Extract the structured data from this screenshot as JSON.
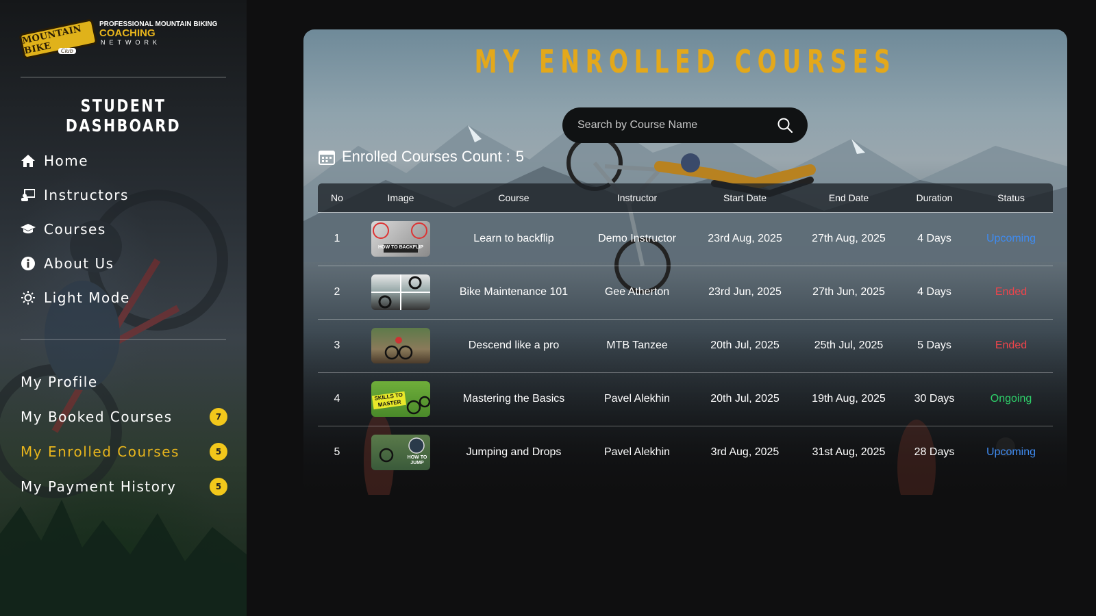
{
  "brand": {
    "badge_text": "MOUNTAIN BIKE",
    "badge_sub": "Club",
    "line1": "PROFESSIONAL MOUNTAIN BIKING",
    "line2": "COACHING",
    "line3": "NETWORK"
  },
  "sidebar": {
    "title": "STUDENT DASHBOARD",
    "nav": [
      {
        "label": "Home",
        "icon": "home-icon"
      },
      {
        "label": "Instructors",
        "icon": "instructor-icon"
      },
      {
        "label": "Courses",
        "icon": "graduation-cap-icon"
      },
      {
        "label": "About Us",
        "icon": "info-icon"
      },
      {
        "label": "Light Mode",
        "icon": "sun-icon"
      }
    ],
    "profile_nav": [
      {
        "label": "My Profile",
        "badge": null,
        "active": false
      },
      {
        "label": "My Booked Courses",
        "badge": "7",
        "active": false
      },
      {
        "label": "My Enrolled Courses",
        "badge": "5",
        "active": true
      },
      {
        "label": "My Payment History",
        "badge": "5",
        "active": false
      }
    ]
  },
  "main": {
    "title": "MY ENROLLED COURSES",
    "search_placeholder": "Search by Course Name",
    "count_label": "Enrolled Courses Count :",
    "count_value": "5",
    "columns": [
      "No",
      "Image",
      "Course",
      "Instructor",
      "Start Date",
      "End Date",
      "Duration",
      "Status"
    ],
    "rows": [
      {
        "no": "1",
        "image_text": "HOW TO BACKFLIP",
        "course": "Learn to backflip",
        "instructor": "Demo Instructor",
        "start": "23rd Aug, 2025",
        "end": "27th Aug, 2025",
        "duration": "4 Days",
        "status": "Upcoming"
      },
      {
        "no": "2",
        "image_text": "",
        "course": "Bike Maintenance 101",
        "instructor": "Gee Atherton",
        "start": "23rd Jun, 2025",
        "end": "27th Jun, 2025",
        "duration": "4 Days",
        "status": "Ended"
      },
      {
        "no": "3",
        "image_text": "",
        "course": "Descend like a pro",
        "instructor": "MTB Tanzee",
        "start": "20th Jul, 2025",
        "end": "25th Jul, 2025",
        "duration": "5 Days",
        "status": "Ended"
      },
      {
        "no": "4",
        "image_text": "SKILLS TO MASTER",
        "course": "Mastering the Basics",
        "instructor": "Pavel Alekhin",
        "start": "20th Jul, 2025",
        "end": "19th Aug, 2025",
        "duration": "30 Days",
        "status": "Ongoing"
      },
      {
        "no": "5",
        "image_text": "HOW TO JUMP",
        "course": "Jumping and Drops",
        "instructor": "Pavel Alekhin",
        "start": "3rd Aug, 2025",
        "end": "31st Aug, 2025",
        "duration": "28 Days",
        "status": "Upcoming"
      }
    ]
  },
  "colors": {
    "accent": "#e3a81b",
    "badge": "#f2c71b",
    "upcoming": "#3f8bf0",
    "ended": "#f0444b",
    "ongoing": "#2ed16a"
  }
}
